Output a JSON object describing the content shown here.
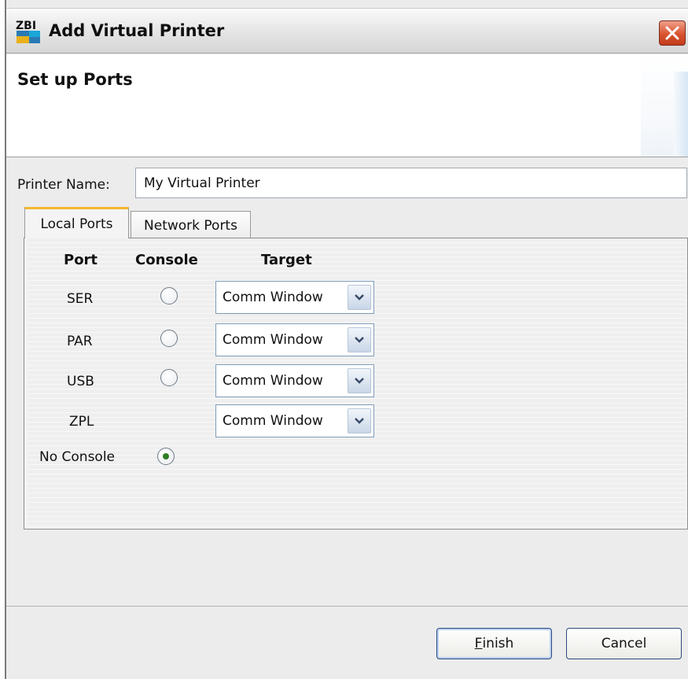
{
  "window": {
    "title": "Add Virtual Printer",
    "logo_text": "ZBI"
  },
  "header": {
    "title": "Set up Ports"
  },
  "printer_name": {
    "label": "Printer Name:",
    "value": "My Virtual Printer"
  },
  "tabs": [
    {
      "label": "Local Ports",
      "active": true
    },
    {
      "label": "Network Ports",
      "active": false
    }
  ],
  "ports_table": {
    "headers": {
      "port": "Port",
      "console": "Console",
      "target": "Target"
    },
    "rows": [
      {
        "port": "SER",
        "console_selected": false,
        "target": "Comm Window"
      },
      {
        "port": "PAR",
        "console_selected": false,
        "target": "Comm Window"
      },
      {
        "port": "USB",
        "console_selected": false,
        "target": "Comm Window"
      },
      {
        "port": "ZPL",
        "target": "Comm Window"
      }
    ],
    "no_console": {
      "label": "No Console",
      "selected": true
    }
  },
  "buttons": {
    "finish": {
      "mnemonic": "F",
      "rest": "inish"
    },
    "cancel": "Cancel"
  },
  "colors": {
    "active_tab_accent": "#f5b62e",
    "close_button": "#d9532f",
    "select_border": "#7f9db9"
  }
}
